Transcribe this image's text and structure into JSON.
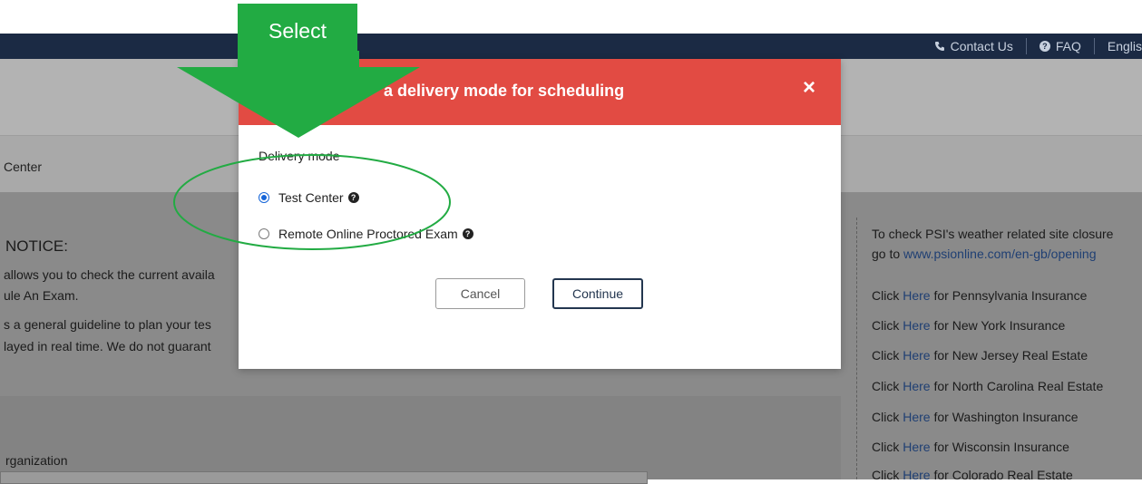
{
  "topnav": {
    "contact": "Contact Us",
    "faq": "FAQ",
    "language": "Englis"
  },
  "breadcrumb": "Center",
  "notice": {
    "title": "NOTICE:",
    "line1": "allows you to check the current availa",
    "line2": "ule An Exam.",
    "line3": "s a general guideline to plan your tes",
    "line4": "layed in real time. We do not guarant"
  },
  "form": {
    "org_label": "rganization"
  },
  "right_panel": {
    "weather_line1": "To check PSI's weather related site closure",
    "weather_prefix": "go to ",
    "weather_link": "www.psionline.com/en-gb/opening",
    "click": "Click ",
    "here": "Here",
    "links": [
      " for Pennsylvania Insurance",
      " for New York Insurance",
      " for New Jersey Real Estate",
      " for North Carolina Real Estate",
      " for Washington Insurance",
      " for Wisconsin Insurance",
      " for Colorado Real Estate"
    ]
  },
  "modal": {
    "title": "a delivery mode for scheduling",
    "close": "×",
    "mode_label": "Delivery mode",
    "option1": "Test Center",
    "option2": "Remote Online Proctored Exam",
    "selected": "Test Center",
    "cancel": "Cancel",
    "continue": "Continue"
  },
  "annotation": {
    "label": "Select",
    "color": "#22ab43"
  },
  "colors": {
    "modal_header": "#e24b43",
    "topbar": "#1b2a44",
    "link": "#1f3f73"
  }
}
